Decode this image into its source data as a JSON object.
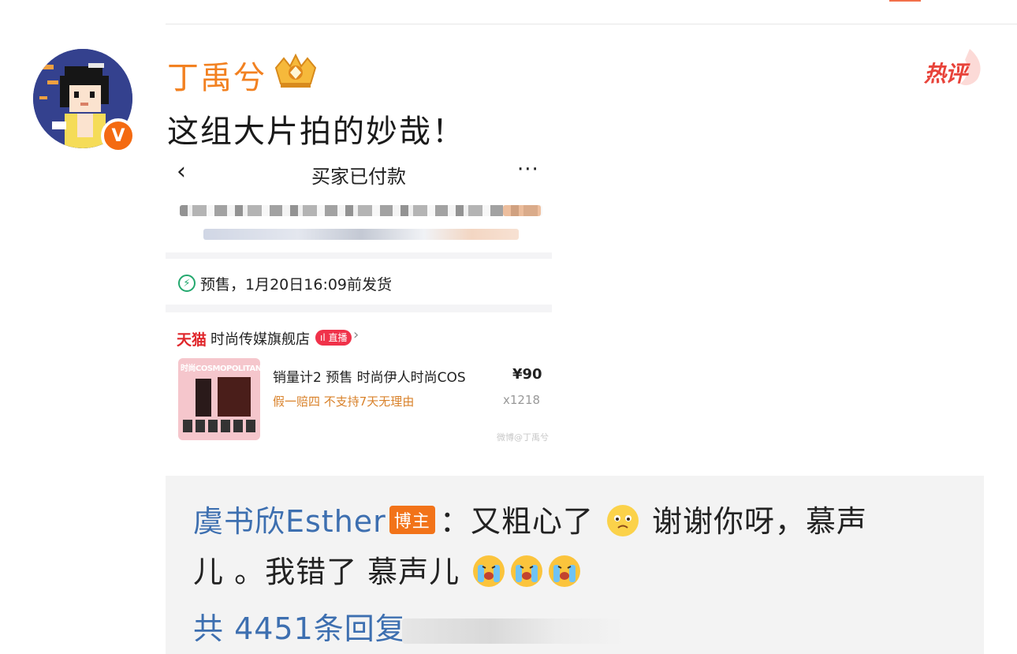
{
  "post": {
    "username": "丁禹兮",
    "text": "这组大片拍的妙哉！",
    "hot_badge": "热评",
    "verified_mark": "V"
  },
  "screenshot": {
    "back_icon": "‹",
    "title": "买家已付款",
    "more_icon": "···",
    "presale_icon": "⚡",
    "presale_text": "预售，1月20日16:09前发货",
    "store_logo": "天猫",
    "store_name": "时尚传媒旗舰店",
    "live_badge": "ıl 直播",
    "store_chevron": "›",
    "product_image_text": "时尚COSMOPOLITAN",
    "product_title": "销量计2 预售 时尚伊人时尚COS",
    "product_price": "¥90",
    "product_tags": "假一赔四   不支持7天无理由",
    "product_qty": "x1218",
    "watermark": "微博@丁禹兮"
  },
  "reply": {
    "author": "虞书欣Esther",
    "author_badge": "博主",
    "text_part1": "：又粗心了",
    "text_part2": " 谢谢你呀，慕声",
    "text_line2": "儿 。我错了 慕声儿",
    "count_text": "共 4451条回复",
    "emoji_1": "sad-face-emoji",
    "emoji_2": "crying-face-emoji"
  },
  "colors": {
    "username": "#f28121",
    "reply_name": "#3d6fb0",
    "hot": "#e8433a",
    "verified": "#f46a11"
  }
}
